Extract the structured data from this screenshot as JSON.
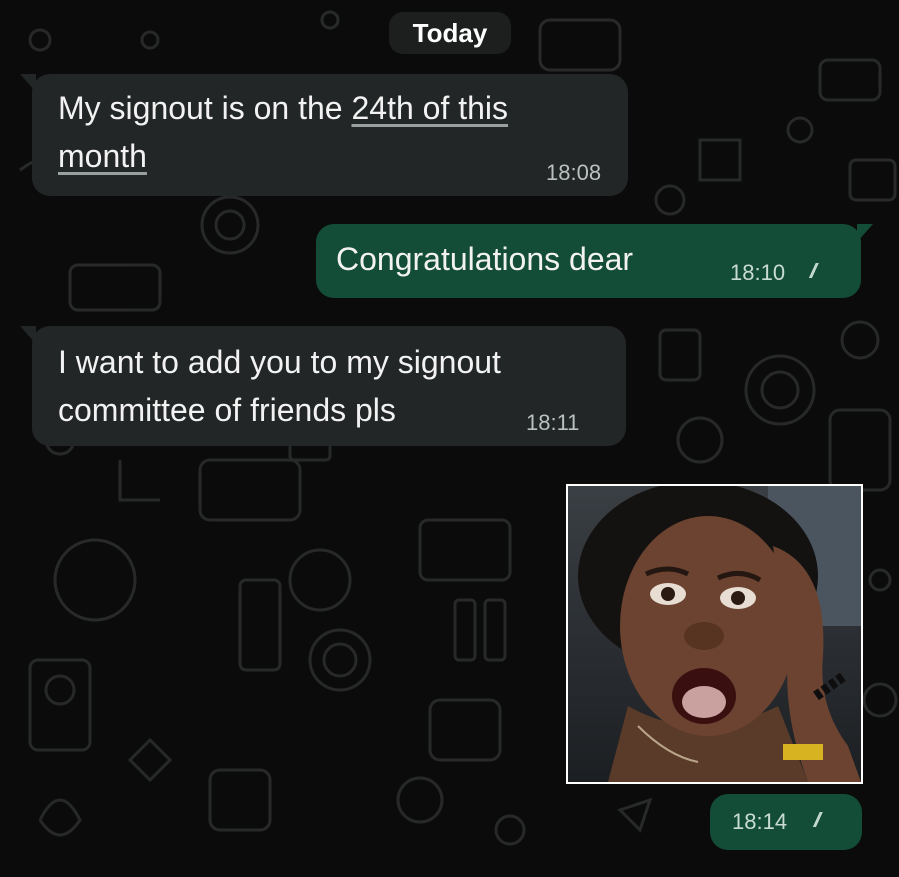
{
  "day_header": "Today",
  "messages": [
    {
      "direction": "incoming",
      "text_prefix": "My signout is on the ",
      "link_line1": "24th of this",
      "link_line2": "month",
      "time": "18:08"
    },
    {
      "direction": "outgoing",
      "text": "Congratulations dear",
      "time": "18:10",
      "ticks": "//"
    },
    {
      "direction": "incoming",
      "line1": "I want to add you to my signout",
      "line2": "committee of friends pls",
      "time": "18:11"
    },
    {
      "direction": "outgoing",
      "type": "image",
      "image_description_icon": "photo-surprised-woman",
      "time": "18:14",
      "ticks": "//"
    }
  ],
  "colors": {
    "background": "#0b0b0b",
    "incoming_bubble": "#232626",
    "outgoing_bubble": "#134d37",
    "text": "#f2f2f2"
  }
}
